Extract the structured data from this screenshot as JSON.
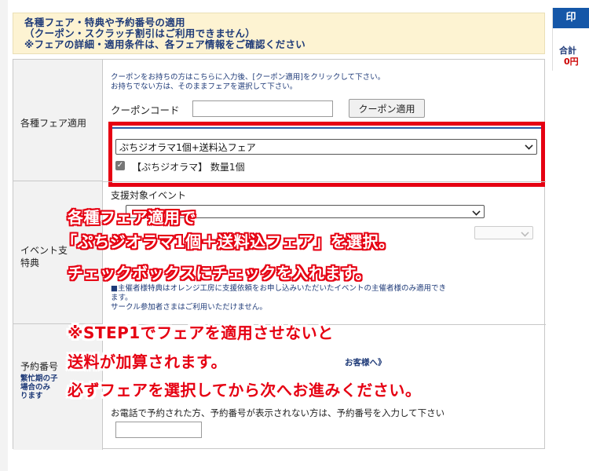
{
  "header": {
    "line1": "各種フェア・特典や予約番号の適用",
    "line2": "（クーポン・スクラッチ割引はご利用できません）",
    "line3": "※フェアの詳細・適用条件は、各フェア情報をご確認ください"
  },
  "right_panel": {
    "top_label": "印",
    "total_label": "合計",
    "total_value": "0円"
  },
  "fair_row": {
    "label": "各種フェア適用",
    "note_line1": "クーポンをお持ちの方はこちらに入力後、[クーポン適用]をクリックして下さい。",
    "note_line2": "お持ちでない方は、そのままフェアを選択して下さい。",
    "coupon_label": "クーポンコード",
    "coupon_value": "",
    "coupon_button": "クーポン適用",
    "fair_selected": "ぷちジオラマ1個+送料込フェア",
    "checkbox_checked": true,
    "checkbox_label": "【ぷちジオラマ】 数量1個"
  },
  "event_row": {
    "label_line1": "イベント支",
    "label_line2": "特典",
    "event_label": "支援対象イベント",
    "note_line1": "■主催者様特典はオレンジ工房に支援依頼をお申し込みいただいたイベントの主催者様のみ適用でき",
    "note_line2": "ます。",
    "note_line3": "サークル参加者さまはご利用いただけません。"
  },
  "reservation_row": {
    "label": "予約番号",
    "small_line1": "繁忙期の子",
    "small_line2": "場合のみ",
    "small_line3": "ります",
    "right_note": "お客様へ》",
    "instruction": "お電話で予約された方、予約番号が表示されない方は、予約番号を入力して下さい",
    "reservation_value": ""
  },
  "annotation": {
    "line1": "各種フェア適用で",
    "line2": "「ぷちジオラマ1個＋送料込フェア」を選択。",
    "line3": "チェックボックスにチェックを入れます。",
    "line4": "※STEP1でフェアを適用させないと",
    "line5": "送料が加算されます。",
    "line6": "必ずフェアを選択してから次へお進みください。"
  },
  "colors": {
    "highlight_red": "#e60012",
    "header_bg": "#fdf3d2",
    "header_text": "#1e3a78",
    "panel_blue": "#1557a8"
  }
}
